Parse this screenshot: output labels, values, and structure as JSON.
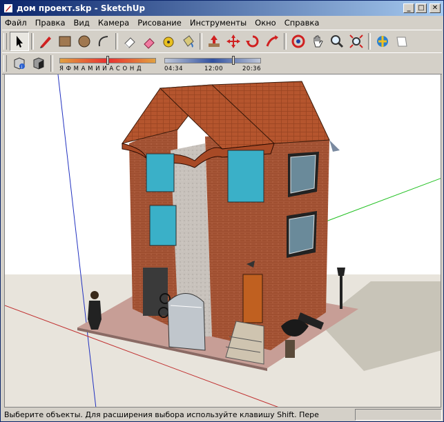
{
  "window": {
    "title": "дом проект.skp - SketchUp"
  },
  "title_buttons": {
    "minimize": "_",
    "maximize": "□",
    "close": "✕"
  },
  "menu": [
    "Файл",
    "Правка",
    "Вид",
    "Камера",
    "Рисование",
    "Инструменты",
    "Окно",
    "Справка"
  ],
  "toolbar": {
    "tools": [
      "select-tool-icon",
      "pencil-tool-icon",
      "rectangle-tool-icon",
      "circle-tool-icon",
      "arc-tool-icon",
      "eraser-tool-icon",
      "paint-eraser-icon",
      "tape-measure-icon",
      "paint-bucket-icon",
      "push-pull-icon",
      "move-tool-icon",
      "rotate-tool-icon",
      "follow-me-icon",
      "orbit-tool-icon",
      "pan-tool-icon",
      "zoom-tool-icon",
      "zoom-extents-icon",
      "get-models-icon",
      "share-model-icon"
    ]
  },
  "shadow_settings": {
    "months_label": "Я Ф М А М И И А С О Н Д",
    "time_start": "04:34",
    "time_mid": "12:00",
    "time_end": "20:36",
    "date_fraction": 0.5,
    "time_fraction": 0.72
  },
  "status": {
    "message": "Выберите объекты. Для расширения выбора используйте клавишу Shift. Пере"
  },
  "colors": {
    "accent": "#0a246a",
    "roof": "#b5552e",
    "brick": "#9a4a2c",
    "ground": "#c79e96"
  }
}
